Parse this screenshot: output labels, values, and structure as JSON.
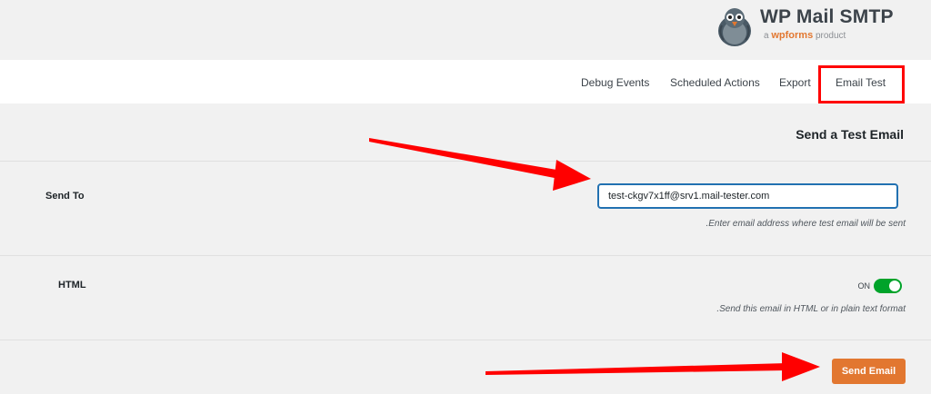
{
  "brand": {
    "name": "WP Mail SMTP",
    "tagline_prefix": "a",
    "tagline_brand": "wpforms",
    "tagline_suffix": "product"
  },
  "tabs": [
    {
      "label": "Debug Events"
    },
    {
      "label": "Scheduled Actions"
    },
    {
      "label": "Export"
    },
    {
      "label": "Email Test",
      "active": true
    }
  ],
  "section": {
    "title": "Send a Test Email"
  },
  "send_to": {
    "label": "Send To",
    "value": "test-ckgv7x1ff@srv1.mail-tester.com",
    "description": ".Enter email address where test email will be sent"
  },
  "html": {
    "label": "HTML",
    "toggle_label": "ON",
    "enabled": true,
    "description": ".Send this email in HTML or in plain text format"
  },
  "actions": {
    "send_label": "Send Email"
  },
  "colors": {
    "accent_orange": "#e27730",
    "toggle_green": "#00a32a",
    "focus_blue": "#2271b1",
    "annotation_red": "#ff0000"
  },
  "icons": {
    "logo": "pigeon-mascot-icon"
  }
}
